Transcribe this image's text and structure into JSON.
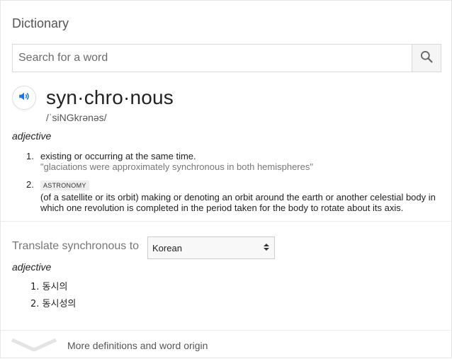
{
  "card": {
    "title": "Dictionary",
    "search": {
      "placeholder": "Search for a word",
      "value": ""
    },
    "entry": {
      "word": "syn·chro·nous",
      "phonetic": "/ˈsiNGkrənəs/",
      "part_of_speech": "adjective",
      "definitions": [
        {
          "number": "1.",
          "text": "existing or occurring at the same time.",
          "example": "\"glaciations were approximately synchronous in both hemispheres\""
        },
        {
          "number": "2.",
          "tag": "ASTRONOMY",
          "text": "(of a satellite or its orbit) making or denoting an orbit around the earth or another celestial body in which one revolution is completed in the period taken for the body to rotate about its axis."
        }
      ]
    },
    "translate": {
      "label": "Translate synchronous to",
      "selected_language": "Korean",
      "part_of_speech": "adjective",
      "items": [
        {
          "number": "1.",
          "text": "동시의"
        },
        {
          "number": "2.",
          "text": "동시성의"
        }
      ]
    },
    "more_link": "More definitions and word origin"
  },
  "colors": {
    "accent": "#1a73e8",
    "muted": "#777777"
  },
  "icons": {
    "search": "search-icon",
    "speaker": "speaker-icon",
    "expand": "chevron-down-icon",
    "select": "select-arrows-icon"
  }
}
